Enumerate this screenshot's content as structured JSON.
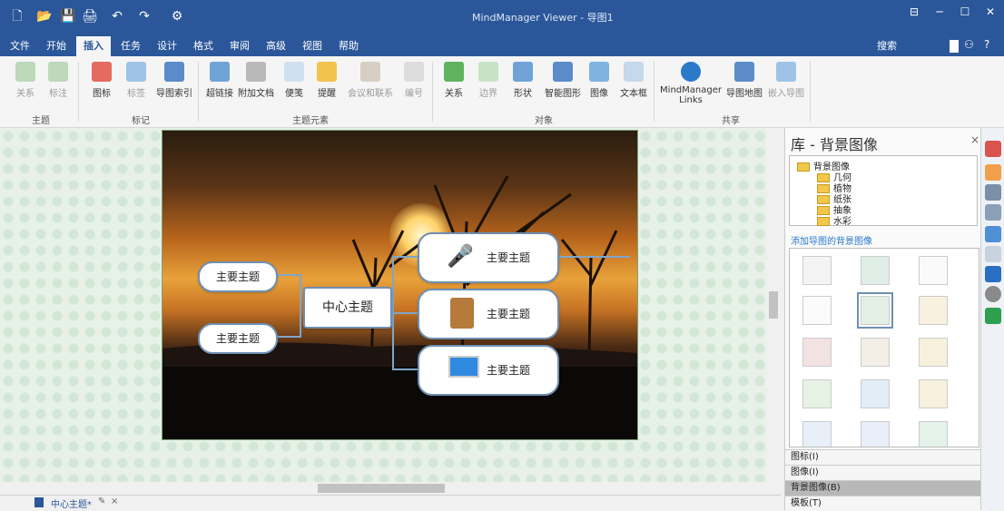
{
  "window": {
    "title": "MindManager Viewer - 导图1",
    "controls": {
      "ribbon_options": "⊟",
      "minimize": "─",
      "maximize": "☐",
      "close": "✕"
    }
  },
  "menu": {
    "tabs": [
      "文件",
      "开始",
      "插入",
      "任务",
      "设计",
      "格式",
      "审阅",
      "高级",
      "视图",
      "帮助"
    ],
    "active_tab": "插入",
    "search_label": "搜索"
  },
  "ribbon": {
    "groups": [
      {
        "label": "主题",
        "buttons": [
          "关系",
          "标注"
        ]
      },
      {
        "label": "标记",
        "buttons": [
          "图标",
          "标签",
          "导图索引"
        ]
      },
      {
        "label": "主题元素",
        "buttons": [
          "超链接",
          "附加文档",
          "便笺",
          "提醒",
          "会议和联系",
          "编号"
        ]
      },
      {
        "label": "对象",
        "buttons": [
          "关系",
          "边界",
          "形状",
          "智能图形",
          "图像",
          "文本框"
        ]
      },
      {
        "label": "共享",
        "buttons": [
          "MindManager Links",
          "导图地图",
          "嵌入导图"
        ]
      }
    ]
  },
  "map": {
    "central_topic": "中心主题",
    "left_topics": [
      "主要主题",
      "主要主题"
    ],
    "right_topics": [
      "主要主题",
      "主要主题",
      "主要主题"
    ]
  },
  "status": {
    "doc_tab": "中心主题*"
  },
  "panel": {
    "title": "库 - 背景图像",
    "tree_root": "背景图像",
    "tree_items": [
      "几何",
      "植物",
      "纸张",
      "抽象",
      "水彩"
    ],
    "link_text": "添加导图的背景图像",
    "sections": [
      "图标(I)",
      "图像(I)",
      "背景图像(B)",
      "模板(T)"
    ],
    "active_section": "背景图像(B)"
  },
  "colors": {
    "title_bar": "#2b579a",
    "topic_border": "#6e8fb3",
    "canvas_bg": "#e7f1e8"
  }
}
